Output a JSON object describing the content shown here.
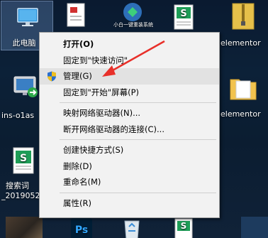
{
  "desktop": {
    "icons": [
      {
        "id": "this-pc",
        "label": "此电脑"
      },
      {
        "id": "xiaobai-tool",
        "label": "小白一键重装系统"
      },
      {
        "id": "elementor-file",
        "label": "elementor"
      },
      {
        "id": "ins-remote",
        "label": "ins-o1as"
      },
      {
        "id": "elementor-folder",
        "label": "elementor"
      },
      {
        "id": "search-word",
        "label": "搜索词"
      },
      {
        "id": "search-word-date",
        "label": "_2019052"
      }
    ],
    "taskbar_icons": [
      "ps-icon",
      "recycle-bin-icon",
      "wps-sheet-icon"
    ]
  },
  "menu": {
    "items": [
      {
        "label": "打开(O)",
        "bold": true
      },
      {
        "label": "固定到\"快速访问\""
      },
      {
        "label": "管理(G)",
        "hover": true,
        "icon": "shield-icon"
      },
      {
        "label": "固定到\"开始\"屏幕(P)"
      },
      {
        "label": "映射网络驱动器(N)..."
      },
      {
        "label": "断开网络驱动器的连接(C)..."
      },
      {
        "label": "创建快捷方式(S)"
      },
      {
        "label": "删除(D)"
      },
      {
        "label": "重命名(M)"
      },
      {
        "label": "属性(R)"
      }
    ]
  },
  "annotation": {
    "arrow_color": "#e8302a"
  },
  "colors": {
    "menu_bg": "#f2f2f2",
    "hover_bg": "#e2e2e2",
    "wps_green": "#1e9e57"
  }
}
